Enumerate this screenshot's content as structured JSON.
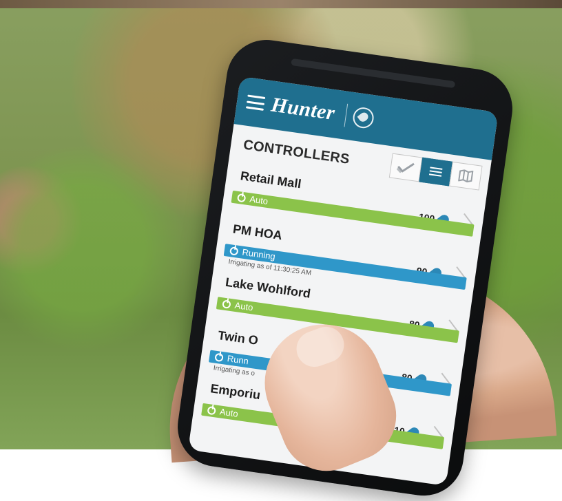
{
  "app": {
    "brand": "Hunter",
    "section_title": "CONTROLLERS",
    "colors": {
      "primary": "#1F6F8F",
      "auto": "#8BC34A",
      "running": "#2F97C9"
    }
  },
  "controllers": [
    {
      "name": "Retail Mall",
      "status": "Auto",
      "value": "100",
      "note": ""
    },
    {
      "name": "PM HOA",
      "status": "Running",
      "value": "90",
      "note": "Irrigating as of 11:30:25 AM"
    },
    {
      "name": "Lake Wohlford",
      "status": "Auto",
      "value": "80",
      "note": ""
    },
    {
      "name": "Twin O",
      "status": "Runn",
      "value": "80",
      "note": "Irrigating as o"
    },
    {
      "name": "Emporiu",
      "status": "Auto",
      "value": "10",
      "note": ""
    }
  ]
}
